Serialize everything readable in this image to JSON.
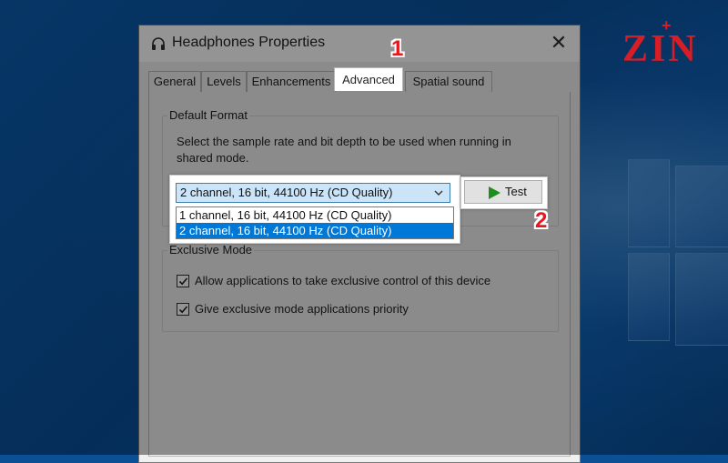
{
  "brand": {
    "logo_text": "ZIN",
    "logo_accent": "+",
    "color": "#d71e27"
  },
  "window": {
    "title": "Headphones Properties",
    "close_glyph": "✕",
    "icon": "headphones-icon"
  },
  "tabs": [
    {
      "label": "General"
    },
    {
      "label": "Levels"
    },
    {
      "label": "Enhancements"
    },
    {
      "label": "Advanced",
      "active": true
    },
    {
      "label": "Spatial sound"
    }
  ],
  "default_format": {
    "group_label": "Default Format",
    "description": "Select the sample rate and bit depth to be used when running in shared mode.",
    "selected": "2 channel, 16 bit, 44100 Hz (CD Quality)",
    "options": [
      "1 channel, 16 bit, 44100 Hz (CD Quality)",
      "2 channel, 16 bit, 44100 Hz (CD Quality)"
    ],
    "test_label": "Test"
  },
  "exclusive_mode": {
    "group_label": "Exclusive Mode",
    "options": [
      {
        "label": "Allow applications to take exclusive control of this device",
        "checked": true
      },
      {
        "label": "Give exclusive mode applications priority",
        "checked": true
      }
    ]
  },
  "markers": {
    "step1": "1",
    "step2": "2"
  },
  "colors": {
    "selection": "#0078d7",
    "marker": "#e8171f",
    "test_play": "#1e8f1e"
  }
}
